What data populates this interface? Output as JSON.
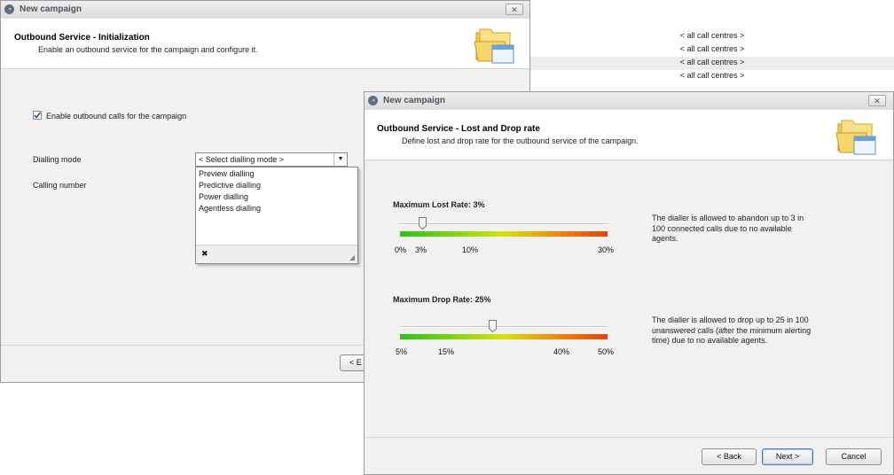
{
  "bg_window": {
    "items": [
      "< all call centres >",
      "< all call centres >",
      "< all call centres >",
      "< all call centres >"
    ]
  },
  "window1": {
    "title": "New campaign",
    "close": "✕",
    "header_title": "Outbound Service - Initialization",
    "header_subtitle": "Enable an outbound service for the campaign and configure it.",
    "enable_checkbox_label": "Enable outbound calls for the campaign",
    "enable_checked": true,
    "dialling_mode_label": "Dialling mode",
    "dialling_mode_placeholder": "< Select dialling mode >",
    "calling_number_label": "Calling number",
    "dropdown_options": [
      "Preview dialling",
      "Predictive dialling",
      "Power dialling",
      "Agentless dialling"
    ],
    "dropdown_clear": "✖",
    "back_button_partial": "< E"
  },
  "window2": {
    "title": "New campaign",
    "close": "✕",
    "header_title": "Outbound Service - Lost and Drop rate",
    "header_subtitle": "Define lost and drop rate for the outbound service of the campaign.",
    "lost": {
      "title": "Maximum Lost Rate: 3%",
      "value_percent": 3,
      "min": 0,
      "max": 30,
      "ticks": [
        "0%",
        "3%",
        "10%",
        "30%"
      ],
      "description": "The dialler is allowed to abandon up to 3 in 100 connected calls due to no available agents."
    },
    "drop": {
      "title": "Maximum Drop Rate: 25%",
      "value_percent": 25,
      "min": 5,
      "max": 50,
      "ticks": [
        "5%",
        "15%",
        "40%",
        "50%"
      ],
      "description": "The dialler is allowed to drop up to 25 in 100 unanswered calls (after the minimum alerting time) due to no available agents."
    },
    "back_button": "< Back",
    "next_button": "Next >",
    "cancel_button": "Cancel"
  }
}
